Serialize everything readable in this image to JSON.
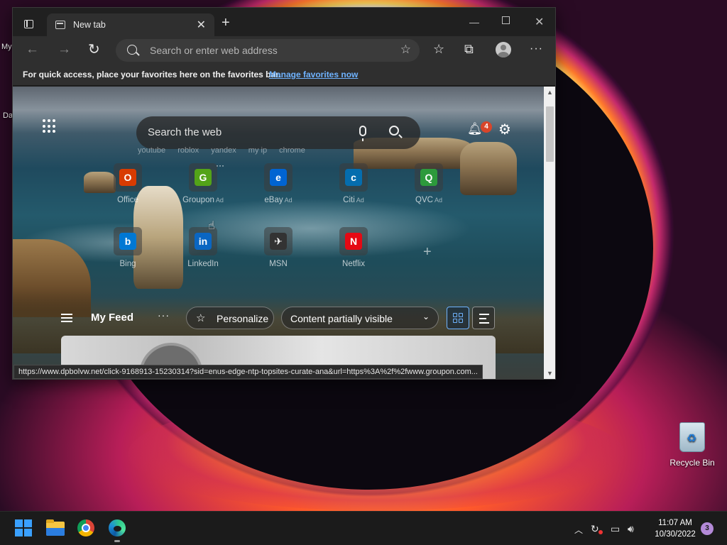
{
  "desktop": {
    "clipped_label_1": "My",
    "clipped_label_2": "Da",
    "recycle_bin_label": "Recycle Bin"
  },
  "browser": {
    "tab_title": "New tab",
    "address_placeholder": "Search or enter web address",
    "favbar_message": "For quick access, place your favorites here on the favorites bar.",
    "favbar_link": "Manage favorites now",
    "status_url": "https://www.dpbolvw.net/click-9168913-15230314?sid=enus-edge-ntp-topsites-curate-ana&url=https%3A%2f%2fwww.groupon.com..."
  },
  "ntp": {
    "search_placeholder": "Search the web",
    "quick_links": [
      "youtube",
      "roblox",
      "yandex",
      "my ip",
      "chrome"
    ],
    "notification_count": "4",
    "tiles": [
      {
        "label": "Office",
        "ad": "",
        "glyph": "O",
        "color": "#d83b01"
      },
      {
        "label": "Groupon",
        "ad": "Ad",
        "glyph": "G",
        "color": "#53a318"
      },
      {
        "label": "eBay",
        "ad": "Ad",
        "glyph": "e",
        "color": "#0064d2"
      },
      {
        "label": "Citi",
        "ad": "Ad",
        "glyph": "c",
        "color": "#056dae"
      },
      {
        "label": "QVC",
        "ad": "Ad",
        "glyph": "Q",
        "color": "#2d9a3c"
      },
      {
        "label": "Bing",
        "ad": "",
        "glyph": "b",
        "color": "#0078d4"
      },
      {
        "label": "LinkedIn",
        "ad": "",
        "glyph": "in",
        "color": "#0a66c2"
      },
      {
        "label": "MSN",
        "ad": "",
        "glyph": "✈",
        "color": "#333333"
      },
      {
        "label": "Netflix",
        "ad": "",
        "glyph": "N",
        "color": "#e50914"
      }
    ],
    "feed": {
      "title": "My Feed",
      "personalize": "Personalize",
      "content_visibility": "Content partially visible"
    }
  },
  "taskbar": {
    "time": "11:07 AM",
    "date": "10/30/2022",
    "notification_count": "3"
  },
  "colors": {
    "accent_link": "#6fb3ff",
    "badge_red": "#d9452a"
  }
}
